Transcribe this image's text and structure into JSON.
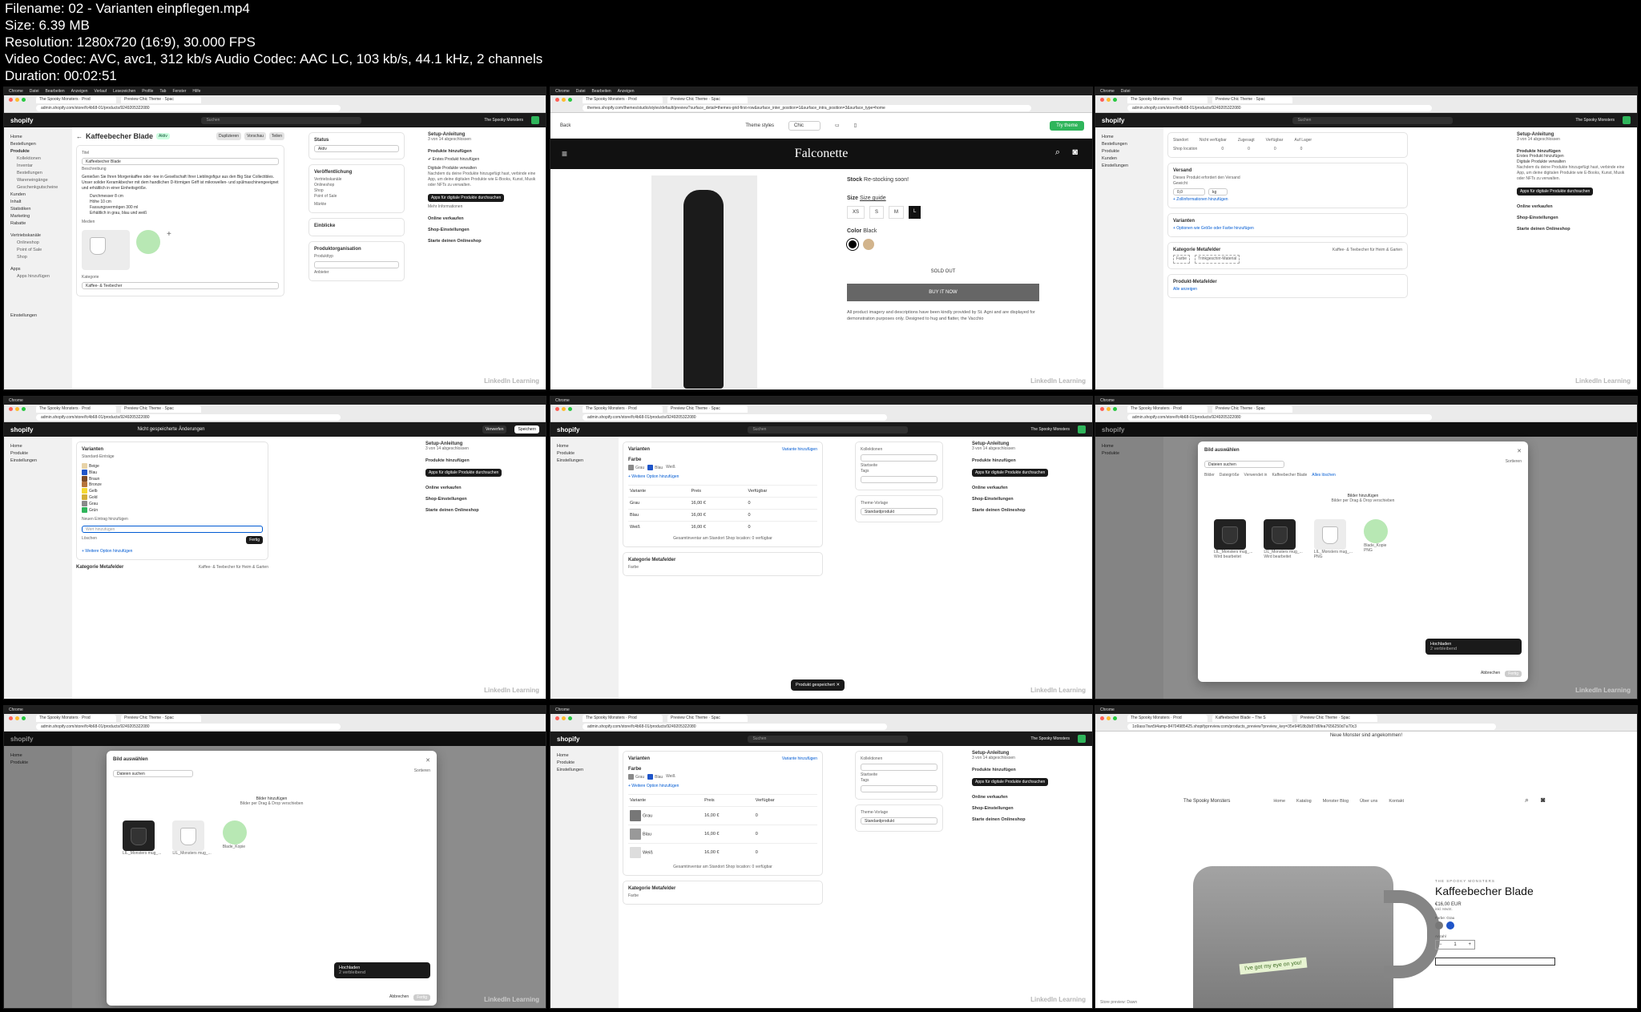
{
  "file_info": {
    "filename": "Filename: 02 - Varianten einpflegen.mp4",
    "size": "Size: 6.39 MB",
    "resolution": "Resolution: 1280x720 (16:9), 30.000 FPS",
    "codec": "Video Codec: AVC, avc1, 312 kb/s Audio Codec: AAC LC, 103 kb/s, 44.1 kHz, 2 channels",
    "duration": "Duration: 00:02:51"
  },
  "browser": {
    "menubar": [
      "Chrome",
      "Datei",
      "Bearbeiten",
      "Anzeigen",
      "Verlauf",
      "Lesezeichen",
      "Profile",
      "Tab",
      "Fenster",
      "Hilfe"
    ],
    "tab_admin": "The Spooky Monsters · Prod",
    "tab_preview": "Preview Chic Theme · Spac",
    "tab_product": "Kaffeebecher Blade – The S",
    "url_admin": "admin.shopify.com/store/fc4b68-01/products/9249205322080",
    "url_theme": "themes.shopify.com/themes/studio/styles/default/preview?surface_detail=themes-grid-first-row&surface_inter_position=1&surface_intra_position=3&surface_type=home",
    "url_store": "1o9ass7iwx5t4amp-84704985425.shopifypreview.com/products_preview?preview_key=35e94f18b3b87d6fea7656250d7a70c3"
  },
  "admin": {
    "logo": "shopify",
    "search": "Suchen",
    "store_name": "The Spooky Monsters",
    "unsaved": "Nicht gespeicherte Änderungen",
    "discard": "Verwerfen",
    "save": "Speichern",
    "sidebar": [
      {
        "label": "Home",
        "sub": false
      },
      {
        "label": "Bestellungen",
        "sub": false
      },
      {
        "label": "Produkte",
        "sub": false
      },
      {
        "label": "Kollektionen",
        "sub": true
      },
      {
        "label": "Inventar",
        "sub": true
      },
      {
        "label": "Bestellungen",
        "sub": true
      },
      {
        "label": "Warenein­gänge",
        "sub": true
      },
      {
        "label": "Geschenkgutscheine",
        "sub": true
      },
      {
        "label": "Kunden",
        "sub": false
      },
      {
        "label": "Inhalt",
        "sub": false
      },
      {
        "label": "Statistiken",
        "sub": false
      },
      {
        "label": "Marketing",
        "sub": false
      },
      {
        "label": "Rabatte",
        "sub": false
      },
      {
        "label": "Vertriebskanäle",
        "sub": false
      },
      {
        "label": "Onlineshop",
        "sub": true
      },
      {
        "label": "Point of Sale",
        "sub": true
      },
      {
        "label": "Shop",
        "sub": true
      },
      {
        "label": "Apps",
        "sub": false
      },
      {
        "label": "Apps hinzufügen",
        "sub": true
      },
      {
        "label": "Einstellungen",
        "sub": false
      }
    ],
    "product_title": "Kaffeebecher Blade",
    "status_badge": "Aktiv",
    "title_label": "Titel",
    "title_value": "Kaffeebecher Blade",
    "desc_label": "Beschreibung",
    "desc_text": "Genießen Sie Ihren Morgenkaffee oder -tee in Gesellschaft Ihrer Lieblingsfigur aus den Big Star Collectibles. Unser solider Keramikbecher mit dem handlichen D-förmigen Griff ist mikrowellen- und spülmaschinengeeignet und erhältlich in einer Einheitsgröße.",
    "bullets": [
      "Durchmesser 8 cm",
      "Höhe 10 cm",
      "Fassungsvermögen 300 ml",
      "Erhältlich in grau, blau und weiß"
    ],
    "media_label": "Medien",
    "category_label": "Kategorie",
    "category_value": "Kaffee- & Teebecher",
    "status_label": "Status",
    "status_value": "Aktiv",
    "publishing": "Veröffentlichung",
    "channels": "Vertriebskanäle",
    "markets": "Märkte",
    "insights": "Einblicke",
    "organisation": "Produktorganisation",
    "product_type": "Produkttyp",
    "vendor": "Anbieter",
    "duplicate": "Duplizieren",
    "preview": "Vorschau",
    "share": "Teilen",
    "shipping": "Versand",
    "shipping_check": "Dieses Produkt erfordert den Versand",
    "weight_label": "Gewicht",
    "weight_value": "0,0",
    "weight_unit": "kg",
    "customs": "+ Zollinformationen hinzufügen",
    "variants": "Varianten",
    "variants_add": "+ Optionen wie Größe oder Farbe hinzufügen",
    "variant_add_link": "Variante hinzufügen",
    "category_fields": "Kategorie Metafelder",
    "category_fields_value": "Kaffee- & Teebecher für Heim & Garten",
    "field_color": "Farbe",
    "field_material": "Trinkgeschirr-Material",
    "product_metafields": "Produkt-Metafelder",
    "show_all": "Alle anzeigen",
    "location_header": [
      "Standort",
      "Nicht verfügbar",
      "Zugesagt",
      "Verfügbar",
      "Auf Lager"
    ],
    "location_row": [
      "Shop location",
      "0",
      "0",
      "0",
      "0"
    ],
    "option_name": "Farbe",
    "option_values": [
      "Grau",
      "Blau",
      "Weiß"
    ],
    "add_option": "+ Weitere Option hinzufügen",
    "color_entries_label": "Standard-Einträge",
    "color_entries": [
      "Beige",
      "Blau",
      "Braun",
      "Bronze",
      "Gelb",
      "Gold",
      "Grau",
      "Grün"
    ],
    "new_entry": "Neuen Eintrag hinzufügen",
    "add_value_placeholder": "Wert hinzufügen",
    "delete": "Löschen",
    "done": "Fertig",
    "variant_cols": [
      "Variante",
      "Preis",
      "Verfügbar"
    ],
    "variant_rows": [
      {
        "name": "Grau",
        "price": "16,00",
        "currency": "€",
        "available": "0"
      },
      {
        "name": "Blau",
        "price": "16,00",
        "currency": "€",
        "available": "0"
      },
      {
        "name": "Weiß",
        "price": "16,00",
        "currency": "€",
        "available": "0"
      }
    ],
    "inventory_total": "Gesamtinventar am Standort Shop location: 0 verfügbar",
    "collections": "Kollektionen",
    "collection_tag": "Startseite",
    "tags": "Tags",
    "theme_template": "Theme-Vorlage",
    "theme_template_value": "Standardprodukt",
    "toast_saved": "Produkt gespeichert",
    "setup": {
      "title": "Setup-Anleitung",
      "progress": "3 von 14 abgeschlossen",
      "section": "Produkte hinzufügen",
      "step1": "Erstes Produkt hinzufügen",
      "step2": "Digitale Produkte verwalten",
      "step2_text": "Nachdem du deine Produkte hinzugefügt hast, verbinde eine App, um deine digitalen Produkte wie E-Books, Kunst, Musik oder NFTs zu verwalten.",
      "cta": "Apps für digitale Produkte durchsuchen",
      "more": "Mehr Informationen",
      "s2": "Online verkaufen",
      "s3": "Shop-Einstellungen",
      "s4": "Starte deinen Onlineshop"
    }
  },
  "image_modal": {
    "title": "Bild auswählen",
    "search": "Dateien suchen",
    "sort": "Sortieren",
    "filters": [
      "Bilder",
      "Dateigröße",
      "Verwendet in",
      "Kaffeebecher Blade",
      "Alles löschen"
    ],
    "upload": "Bilder hinzufügen",
    "upload_hint": "Bilder per Drag & Drop verschieben",
    "files": [
      {
        "name": "LIL_Monsters mug_...",
        "note": "Wird bearbeitet",
        "dark": true
      },
      {
        "name": "LIL_Monsters mug_...",
        "note": "Wird bearbeitet",
        "dark": true
      },
      {
        "name": "LIL_Monsters mug_...",
        "note": "PNG",
        "dark": false
      },
      {
        "name": "Blade_Kopie",
        "note": "PNG",
        "dark": false
      }
    ],
    "toast_title": "Hochladen",
    "toast_sub": "2 verbleibend",
    "cancel": "Abbrechen",
    "done": "Fertig"
  },
  "theme_preview": {
    "back": "Back",
    "styles": "Theme styles",
    "style_value": "Chic",
    "try": "Try theme",
    "brand": "Falconette",
    "stock": "Stock",
    "stock_value": "Re-stocking soon!",
    "size": "Size",
    "size_guide": "Size guide",
    "sizes": [
      "XS",
      "S",
      "M",
      "L"
    ],
    "color": "Color",
    "color_value": "Black",
    "sold_out": "SOLD OUT",
    "buy": "BUY IT NOW",
    "note": "All product imagery and descriptions have been kindly provided by St. Agni and are displayed for demonstration purposes only. Designed to hug and flatter, the Vacchio"
  },
  "storefront": {
    "banner": "Neue Monster sind angekommen!",
    "brand": "The Spooky Monsters",
    "nav": [
      "Home",
      "Katalog",
      "Monster Blog",
      "Über uns",
      "Kontakt"
    ],
    "vendor": "THE SPOOKY MONSTERS",
    "title": "Kaffeebecher Blade",
    "price": "€16,00 EUR",
    "tax": "inkl. MwSt.",
    "color_label": "Farbe: Grau",
    "qty_label": "Anzahl",
    "qty": "1",
    "mug_text": "I've got my eye on you!",
    "footer": "Store preview: Dawn"
  },
  "watermark": "LinkedIn Learning",
  "colors": {
    "admin_topbar": "#1a1a1a",
    "accent_green": "#2fb55b",
    "sidebar_bg": "#f1f1f1",
    "swatch_grau": "#8a8a8a",
    "swatch_blau": "#1f55c9",
    "swatch_weiss": "#ffffff"
  }
}
